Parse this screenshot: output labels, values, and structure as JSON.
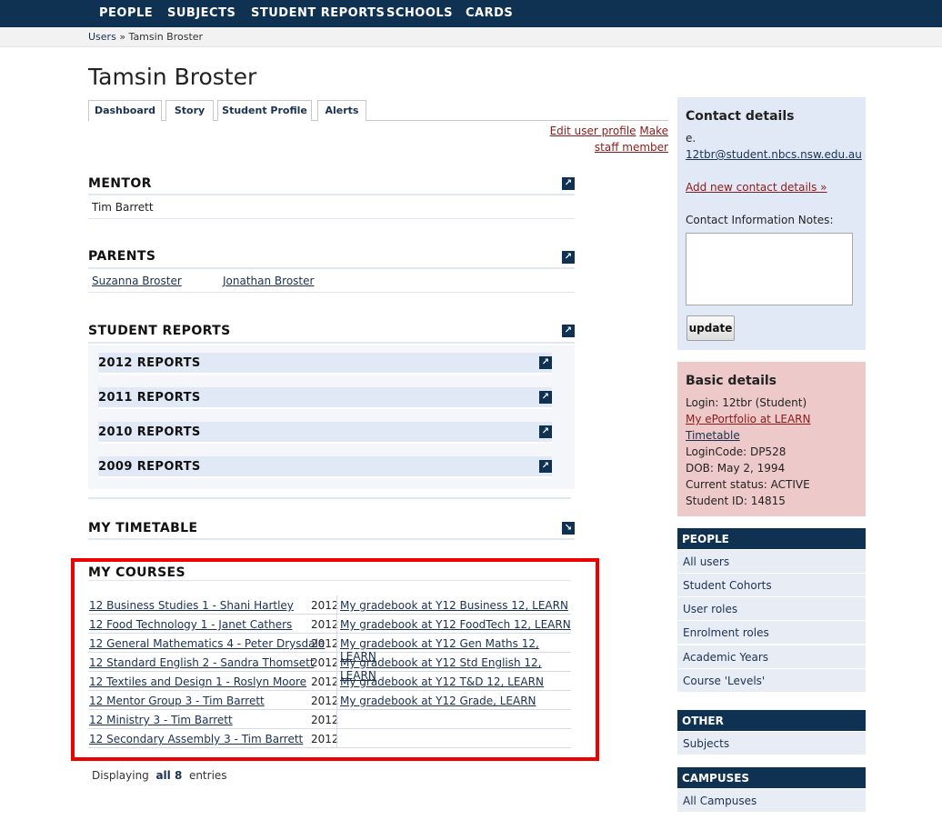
{
  "nav": [
    "PEOPLE",
    "SUBJECTS",
    "STUDENT REPORTS",
    "SCHOOLS",
    "CARDS"
  ],
  "breadcrumb": {
    "parent": "Users",
    "separator": "»",
    "current": "Tamsin Broster"
  },
  "title": "Tamsin Broster",
  "tabs": [
    "Dashboard",
    "Story",
    "Student Profile",
    "Alerts"
  ],
  "profile_links": {
    "edit": "Edit user profile",
    "staff": "Make staff member"
  },
  "mentor": {
    "title": "MENTOR",
    "name": "Tim Barrett"
  },
  "parents": {
    "title": "PARENTS",
    "names": [
      "Suzanna Broster",
      "Jonathan Broster"
    ]
  },
  "reports": {
    "title": "STUDENT REPORTS",
    "years": [
      "2012 REPORTS",
      "2011 REPORTS",
      "2010 REPORTS",
      "2009 REPORTS"
    ]
  },
  "timetable": {
    "title": "MY TIMETABLE"
  },
  "courses": {
    "title": "MY COURSES",
    "rows": [
      {
        "name": "12 Business Studies 1 - Shani Hartley",
        "year": "2012",
        "gradebook": "My gradebook at Y12 Business 12, LEARN"
      },
      {
        "name": "12 Food Technology 1 - Janet Cathers",
        "year": "2012",
        "gradebook": "My gradebook at Y12 FoodTech 12, LEARN"
      },
      {
        "name": "12 General Mathematics 4 - Peter Drysdale",
        "year": "2012",
        "gradebook": "My gradebook at Y12 Gen Maths 12, LEARN"
      },
      {
        "name": "12 Standard English 2 - Sandra Thomsett",
        "year": "2012",
        "gradebook": "My gradebook at Y12 Std English 12, LEARN"
      },
      {
        "name": "12 Textiles and Design 1 - Roslyn Moore",
        "year": "2012",
        "gradebook": "My gradebook at Y12 T&D 12, LEARN"
      },
      {
        "name": "12 Mentor Group 3 - Tim Barrett",
        "year": "2012",
        "gradebook": "My gradebook at Y12 Grade, LEARN"
      },
      {
        "name": "12 Ministry 3 - Tim Barrett",
        "year": "2012",
        "gradebook": ""
      },
      {
        "name": "12 Secondary Assembly 3 - Tim Barrett",
        "year": "2012",
        "gradebook": ""
      }
    ],
    "displaying": {
      "prefix": "Displaying",
      "count": "all 8",
      "suffix": "entries"
    }
  },
  "contact": {
    "title": "Contact details",
    "email_prefix": "e.",
    "email": "12tbr@student.nbcs.nsw.edu.au",
    "add_link": "Add new contact details »",
    "notes_label": "Contact Information Notes:",
    "notes_value": "",
    "update": "update"
  },
  "basic": {
    "title": "Basic details",
    "login": "Login: 12tbr (Student)",
    "eportfolio": "My ePortfolio at LEARN",
    "timetable": "Timetable",
    "logincode": "LoginCode: DP528",
    "dob": "DOB: May 2, 1994",
    "status": "Current status: ACTIVE",
    "student_id": "Student ID: 14815"
  },
  "sidebar": {
    "people": {
      "title": "PEOPLE",
      "items": [
        "All users",
        "Student Cohorts",
        "User roles",
        "Enrolment roles",
        "Academic Years",
        "Course 'Levels'"
      ]
    },
    "other": {
      "title": "OTHER",
      "items": [
        "Subjects"
      ]
    },
    "campuses": {
      "title": "CAMPUSES",
      "items": [
        "All Campuses"
      ]
    }
  },
  "colors": {
    "nav_bg": "#0f3253",
    "highlight_frame": "#ee0000",
    "contact_bg": "#e1e9f6",
    "basic_bg": "#eec9c9",
    "link_red": "#8b1a1a"
  }
}
